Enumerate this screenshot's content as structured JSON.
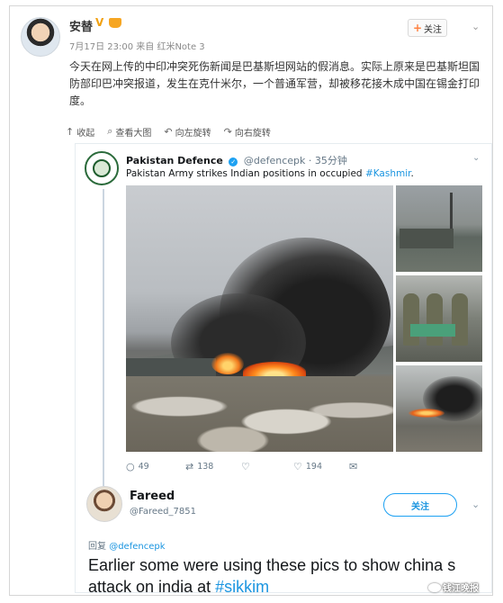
{
  "weibo": {
    "author": "安替",
    "verified_badge": "V",
    "meta": "7月17日 23:00 来自 红米Note 3",
    "follow_label": "关注",
    "body": "今天在网上传的中印冲突死伤新闻是巴基斯坦网站的假消息。实际上原来是巴基斯坦国防部印巴冲突报道，发生在克什米尔，一个普通军营，却被移花接木成中国在锡金打印度。",
    "actions": [
      {
        "icon": "collapse-icon",
        "label": "收起"
      },
      {
        "icon": "zoom-icon",
        "label": "查看大图"
      },
      {
        "icon": "rotate-left-icon",
        "label": "向左旋转"
      },
      {
        "icon": "rotate-right-icon",
        "label": "向右旋转"
      }
    ]
  },
  "tweet": {
    "account_name": "Pakistan Defence",
    "handle_time": "@defencepk · 35分钟",
    "text_prefix": "Pakistan Army strikes Indian positions in occupied ",
    "hashtag": "#Kashmir",
    "text_suffix": ".",
    "stats": {
      "replies": "49",
      "retweets": "138",
      "likes": "194"
    }
  },
  "reply": {
    "name": "Fareed",
    "handle": "@Fareed_7851",
    "follow_label": "关注",
    "replying_label": "回复",
    "replying_to": "@defencepk",
    "text_prefix": "Earlier some were using these pics to show china s attack on india at ",
    "hashtag": "#sikkim"
  },
  "watermark": "钱江晚报",
  "colors": {
    "link_blue": "#1b95e0",
    "weibo_orange": "#ff8140",
    "verified_blue": "#1da1f2"
  }
}
